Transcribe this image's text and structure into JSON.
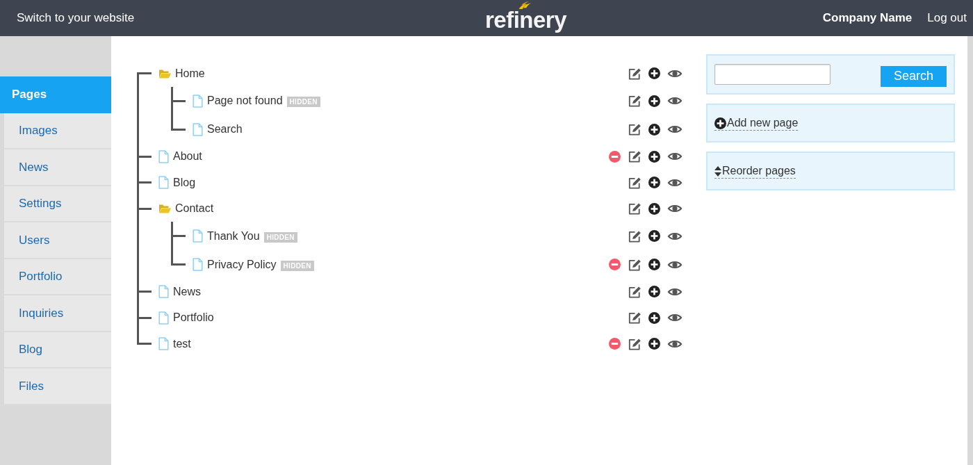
{
  "header": {
    "site_link": "Switch to your website",
    "logo": "refinery",
    "account": "Company Name",
    "logout": "Log out"
  },
  "sidebar": {
    "items": [
      {
        "label": "Pages",
        "selected": true
      },
      {
        "label": "Images",
        "selected": false
      },
      {
        "label": "News",
        "selected": false
      },
      {
        "label": "Settings",
        "selected": false
      },
      {
        "label": "Users",
        "selected": false
      },
      {
        "label": "Portfolio",
        "selected": false
      },
      {
        "label": "Inquiries",
        "selected": false
      },
      {
        "label": "Blog",
        "selected": false
      },
      {
        "label": "Files",
        "selected": false
      }
    ]
  },
  "pages": [
    {
      "title": "Home",
      "kind": "folder",
      "deletable": false,
      "children": [
        {
          "title": "Page not found",
          "kind": "page",
          "badge": "HIDDEN",
          "deletable": false
        },
        {
          "title": "Search",
          "kind": "page",
          "deletable": false
        }
      ]
    },
    {
      "title": "About",
      "kind": "page",
      "deletable": true
    },
    {
      "title": "Blog",
      "kind": "page",
      "deletable": false
    },
    {
      "title": "Contact",
      "kind": "folder",
      "deletable": false,
      "children": [
        {
          "title": "Thank You",
          "kind": "page",
          "badge": "HIDDEN",
          "deletable": false
        },
        {
          "title": "Privacy Policy",
          "kind": "page",
          "badge": "HIDDEN",
          "deletable": true
        }
      ]
    },
    {
      "title": "News",
      "kind": "page",
      "deletable": false
    },
    {
      "title": "Portfolio",
      "kind": "page",
      "deletable": false
    },
    {
      "title": "test",
      "kind": "page",
      "deletable": true
    }
  ],
  "search": {
    "button": "Search"
  },
  "actions": [
    {
      "kind": "add",
      "label": "Add new page"
    },
    {
      "kind": "reorder",
      "label": "Reorder pages"
    }
  ]
}
